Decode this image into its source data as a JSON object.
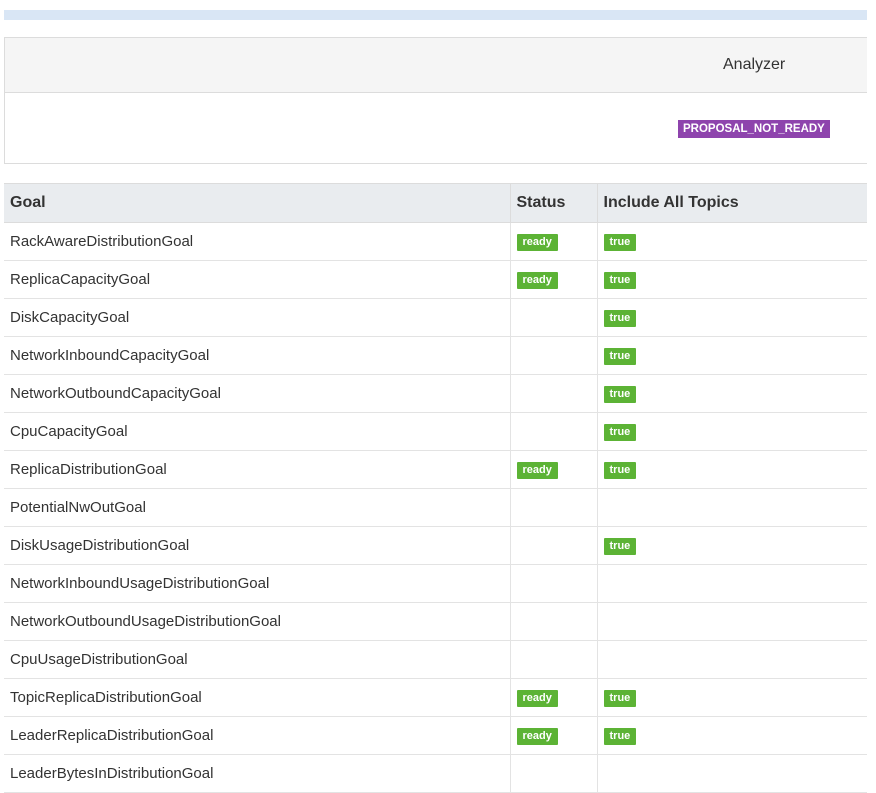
{
  "analyzer": {
    "title": "Analyzer",
    "state": "PROPOSAL_NOT_READY",
    "state_color": "#8e44ad"
  },
  "table": {
    "headers": {
      "goal": "Goal",
      "status": "Status",
      "include": "Include All Topics"
    },
    "badge_color": "#5cb335",
    "rows": [
      {
        "goal": "RackAwareDistributionGoal",
        "status": "ready",
        "include": "true"
      },
      {
        "goal": "ReplicaCapacityGoal",
        "status": "ready",
        "include": "true"
      },
      {
        "goal": "DiskCapacityGoal",
        "status": "",
        "include": "true"
      },
      {
        "goal": "NetworkInboundCapacityGoal",
        "status": "",
        "include": "true"
      },
      {
        "goal": "NetworkOutboundCapacityGoal",
        "status": "",
        "include": "true"
      },
      {
        "goal": "CpuCapacityGoal",
        "status": "",
        "include": "true"
      },
      {
        "goal": "ReplicaDistributionGoal",
        "status": "ready",
        "include": "true"
      },
      {
        "goal": "PotentialNwOutGoal",
        "status": "",
        "include": ""
      },
      {
        "goal": "DiskUsageDistributionGoal",
        "status": "",
        "include": "true"
      },
      {
        "goal": "NetworkInboundUsageDistributionGoal",
        "status": "",
        "include": ""
      },
      {
        "goal": "NetworkOutboundUsageDistributionGoal",
        "status": "",
        "include": ""
      },
      {
        "goal": "CpuUsageDistributionGoal",
        "status": "",
        "include": ""
      },
      {
        "goal": "TopicReplicaDistributionGoal",
        "status": "ready",
        "include": "true"
      },
      {
        "goal": "LeaderReplicaDistributionGoal",
        "status": "ready",
        "include": "true"
      },
      {
        "goal": "LeaderBytesInDistributionGoal",
        "status": "",
        "include": ""
      }
    ]
  }
}
